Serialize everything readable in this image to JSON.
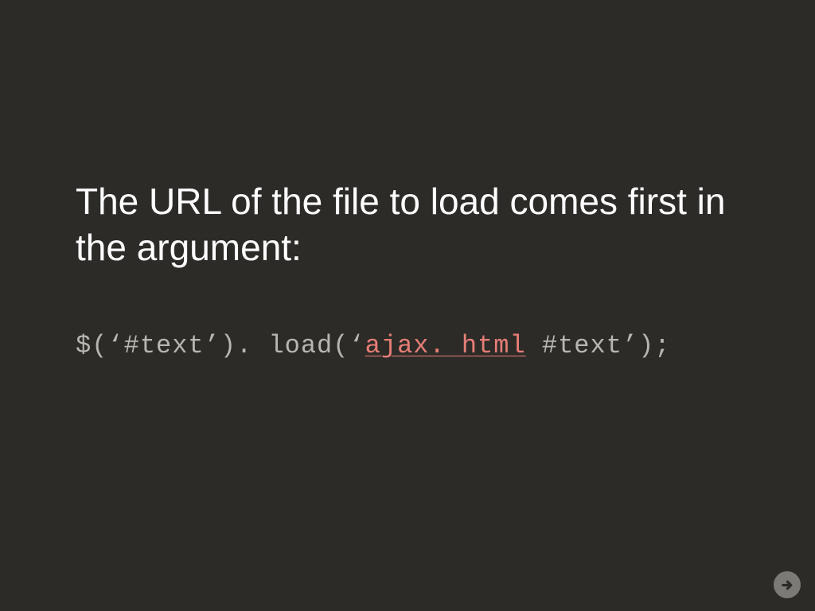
{
  "slide": {
    "heading": "The URL of the file to load comes first in the argument:",
    "code": {
      "prefix": "$(‘#text’). load(‘",
      "highlight": "ajax. html",
      "suffix": " #text’);"
    }
  },
  "controls": {
    "next_label": "Next slide"
  }
}
